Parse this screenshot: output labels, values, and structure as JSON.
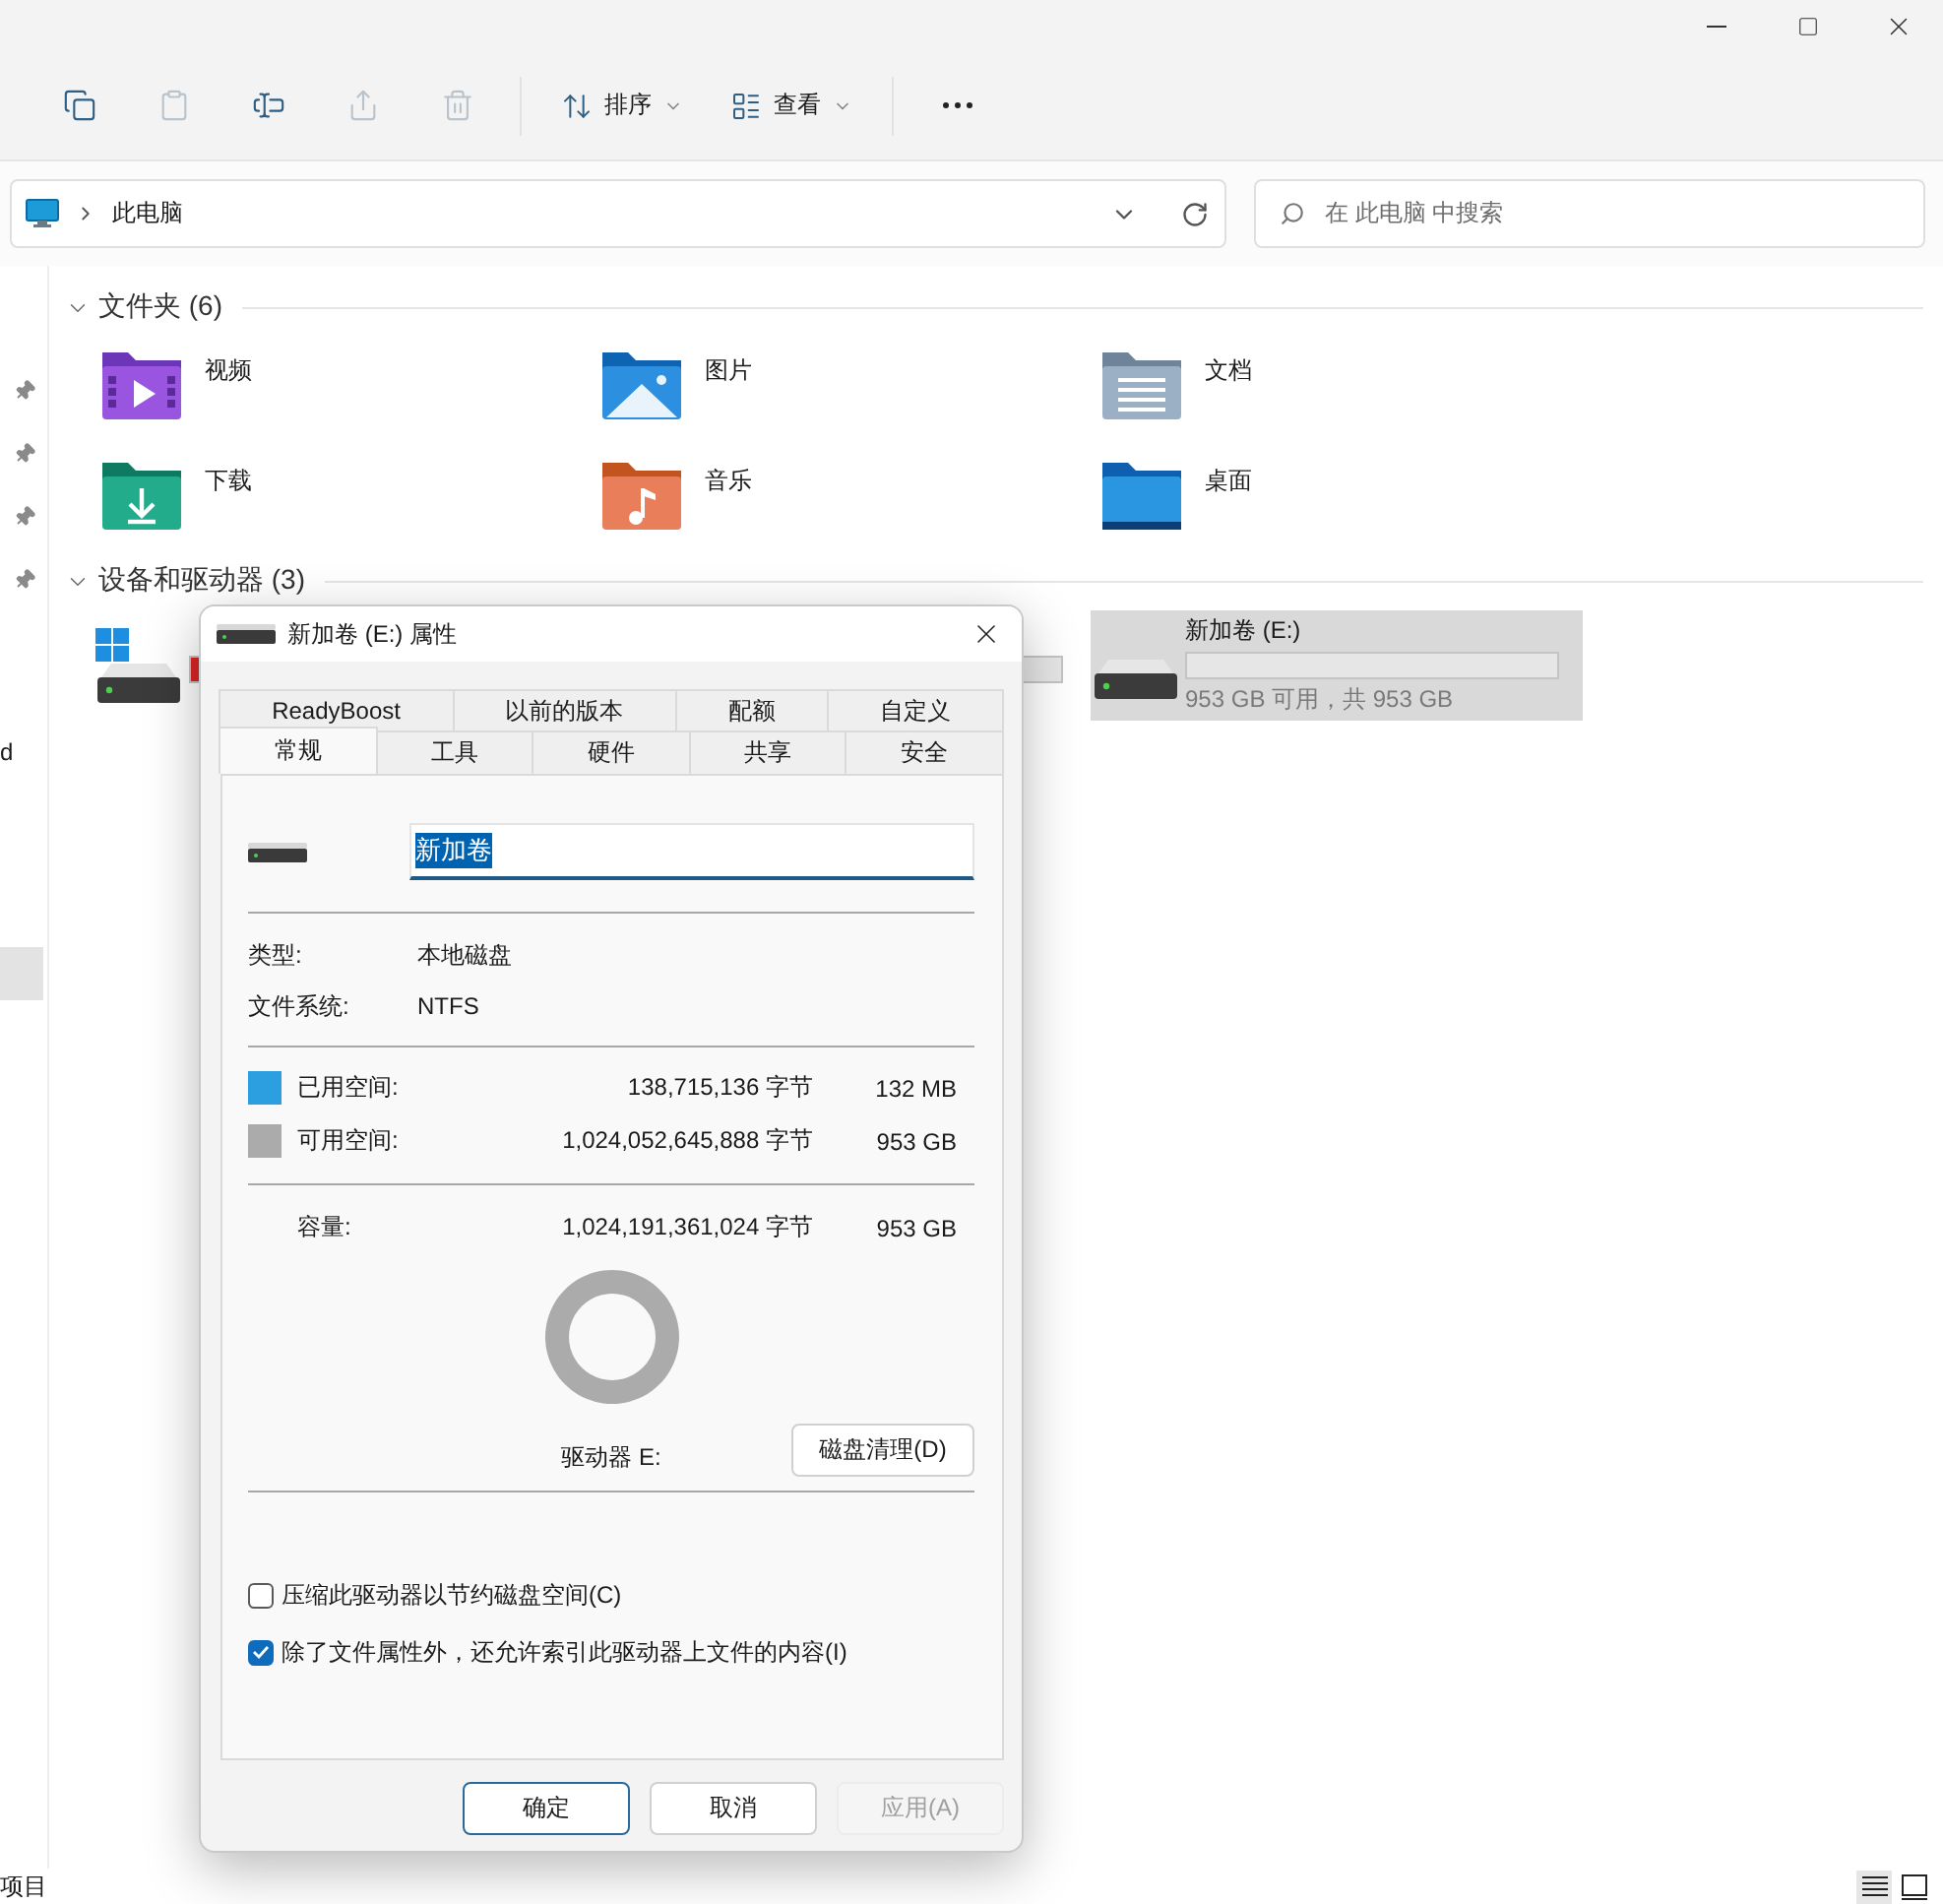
{
  "window": {
    "toolbar": {
      "actions": [
        {
          "kind": "copy",
          "disabled": false
        },
        {
          "kind": "paste",
          "disabled": true
        },
        {
          "kind": "rename",
          "disabled": false
        },
        {
          "kind": "share",
          "disabled": true
        },
        {
          "kind": "delete",
          "disabled": true
        }
      ],
      "menus": [
        {
          "kind": "sort",
          "label": "排序"
        },
        {
          "kind": "view",
          "label": "查看"
        }
      ]
    },
    "address_bar": {
      "location": "此电脑"
    },
    "search": {
      "placeholder": "在 此电脑 中搜索"
    },
    "sidebar": {
      "items": [
        {
          "label": "d",
          "selected": false
        },
        {
          "selected": true
        }
      ]
    },
    "sections": [
      {
        "title": "文件夹 (6)",
        "expanded": true,
        "kind": "folders",
        "items": [
          {
            "name": "视频",
            "kind": "videos"
          },
          {
            "name": "图片",
            "kind": "pictures"
          },
          {
            "name": "文档",
            "kind": "documents"
          },
          {
            "name": "下载",
            "kind": "downloads"
          },
          {
            "name": "音乐",
            "kind": "music"
          },
          {
            "name": "桌面",
            "kind": "desktop"
          }
        ]
      },
      {
        "title": "设备和驱动器 (3)",
        "expanded": true,
        "kind": "drives",
        "items": [
          {
            "kind": "system",
            "level": 0.92,
            "selected": false
          },
          {
            "kind": "covered",
            "selected": false
          },
          {
            "kind": "disk",
            "name": "新加卷 (E:)",
            "status": "953 GB 可用，共 953 GB",
            "selected": true
          }
        ]
      }
    ],
    "status_bar": {
      "item_count": "项目",
      "views": [
        {
          "kind": "details",
          "selected": true
        },
        {
          "kind": "tiles",
          "selected": false
        }
      ]
    }
  },
  "dialog": {
    "title": "新加卷 (E:) 属性",
    "tab_rows": [
      {
        "tabs": [
          {
            "label": "ReadyBoost",
            "selected": false
          },
          {
            "label": "以前的版本",
            "selected": false
          },
          {
            "label": "配额",
            "selected": false
          },
          {
            "label": "自定义",
            "selected": false
          }
        ]
      },
      {
        "tabs": [
          {
            "label": "常规",
            "selected": true
          },
          {
            "label": "工具",
            "selected": false
          },
          {
            "label": "硬件",
            "selected": false
          },
          {
            "label": "共享",
            "selected": false
          },
          {
            "label": "安全",
            "selected": false
          }
        ]
      }
    ],
    "name_field": {
      "value": "新加卷",
      "text_selected": true
    },
    "properties": [
      {
        "label": "类型:",
        "value": "本地磁盘"
      },
      {
        "label": "文件系统:",
        "value": "NTFS"
      }
    ],
    "space": [
      {
        "label": "已用空间:",
        "bytes": "138,715,136 字节",
        "size": "132 MB",
        "color": "#2b9fe0"
      },
      {
        "label": "可用空间:",
        "bytes": "1,024,052,645,888 字节",
        "size": "953 GB",
        "color": "#ababab"
      }
    ],
    "capacity": {
      "label": "容量:",
      "bytes": "1,024,191,361,024 字节",
      "size": "953 GB"
    },
    "drive_label": "驱动器 E:",
    "cleanup_button": "磁盘清理(D)",
    "options": [
      {
        "label": "压缩此驱动器以节约磁盘空间(C)",
        "checked": false
      },
      {
        "label": "除了文件属性外，还允许索引此驱动器上文件的内容(I)",
        "checked": true
      }
    ],
    "buttons": [
      {
        "label": "确定",
        "default": true,
        "disabled": false
      },
      {
        "label": "取消",
        "default": false,
        "disabled": false
      },
      {
        "label": "应用(A)",
        "default": false,
        "disabled": true
      }
    ]
  }
}
